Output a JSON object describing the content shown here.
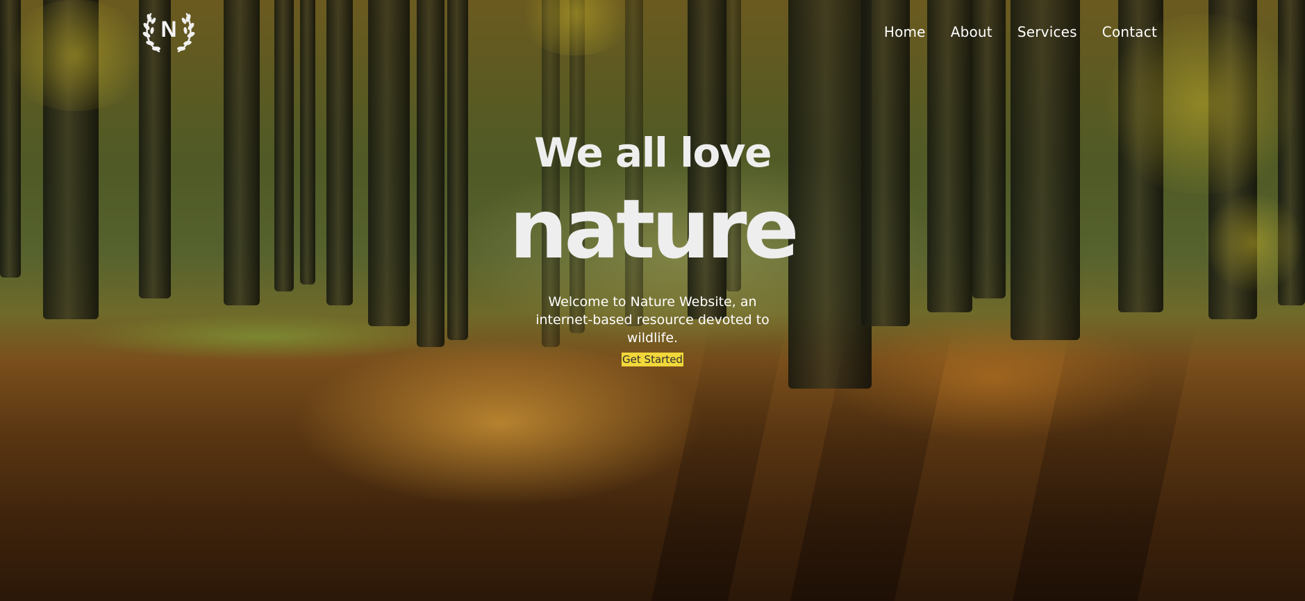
{
  "brand": {
    "logo_letter": "N"
  },
  "nav": {
    "items": [
      {
        "label": "Home"
      },
      {
        "label": "About"
      },
      {
        "label": "Services"
      },
      {
        "label": "Contact"
      }
    ]
  },
  "hero": {
    "subtitle": "We all love",
    "title": "nature",
    "description": "Welcome to Nature Website, an internet-based resource devoted to wildlife.",
    "cta_label": "Get Started"
  },
  "colors": {
    "cta_background": "#f2d73a",
    "text": "#eeeeee"
  },
  "icons": {
    "logo": "laurel-wreath-icon"
  }
}
